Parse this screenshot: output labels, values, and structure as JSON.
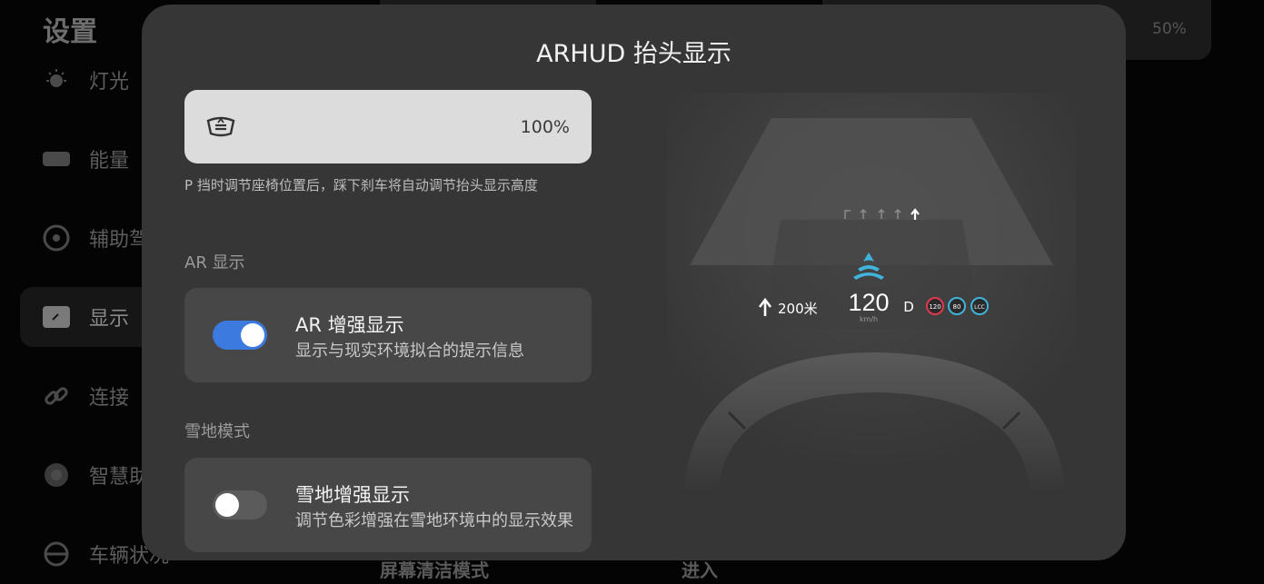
{
  "background": {
    "title": "设置",
    "nav": [
      {
        "label": "灯光",
        "icon": "light-icon"
      },
      {
        "label": "能量",
        "icon": "battery-icon"
      },
      {
        "label": "辅助驾",
        "icon": "steering-assist-icon"
      },
      {
        "label": "显示",
        "icon": "display-icon"
      },
      {
        "label": "连接",
        "icon": "link-icon"
      },
      {
        "label": "智慧助",
        "icon": "smart-icon"
      },
      {
        "label": "车辆状况",
        "icon": "vehicle-status-icon"
      }
    ],
    "brightness_value": "50%",
    "screen_clean_label": "屏幕清洁模式",
    "enter_label": "进入"
  },
  "modal": {
    "title": "ARHUD 抬头显示",
    "height": {
      "icon": "hud-height-icon",
      "value": "100%",
      "level": 1.0
    },
    "hint": "P 挡时调节座椅位置后，踩下刹车将自动调节抬头显示高度",
    "ar_section": "AR 显示",
    "ar_toggle": {
      "title": "AR 增强显示",
      "subtitle": "显示与现实环境拟合的提示信息",
      "on": true
    },
    "snow_section": "雪地模式",
    "snow_toggle": {
      "title": "雪地增强显示",
      "subtitle": "调节色彩增强在雪地环境中的显示效果",
      "on": false
    }
  },
  "hud_preview": {
    "distance": "200米",
    "speed": "120",
    "speed_unit": "km/h",
    "gear": "D",
    "signs": [
      "120",
      "80",
      "LCC"
    ],
    "colors": {
      "accent": "#3fb3d9",
      "sign_red": "#e0384f",
      "sign_blue": "#3fb3d9"
    }
  }
}
